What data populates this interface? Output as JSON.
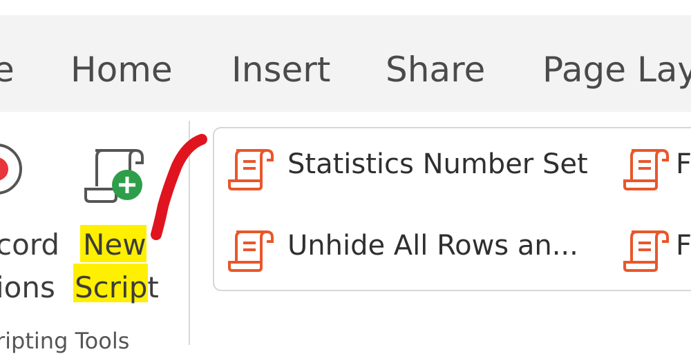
{
  "tabs": [
    {
      "label": "e"
    },
    {
      "label": "Home"
    },
    {
      "label": "Insert"
    },
    {
      "label": "Share"
    },
    {
      "label": "Page Layo"
    }
  ],
  "ribbon": {
    "record_label_line1": "cord",
    "record_label_line2": "ions",
    "new_script_line1": "New",
    "new_script_line2": "Script",
    "group_label": "ripting Tools"
  },
  "scripts": [
    {
      "label": "Statistics Number Set"
    },
    {
      "label": "Unhide All Rows an..."
    },
    {
      "label": "F"
    },
    {
      "label": "F"
    }
  ],
  "colors": {
    "script_icon": "#e8572a",
    "record_dot": "#e8363c",
    "highlight": "#ffef00",
    "annotation": "#e0141e",
    "plus_badge": "#2e9e4a"
  }
}
